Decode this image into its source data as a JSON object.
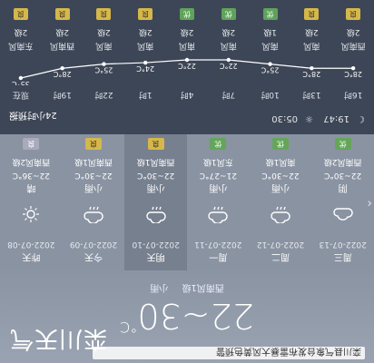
{
  "header": {
    "headline": "栾川县气象台发布雷暴大风黄色预警",
    "city": "栾川天气",
    "temp_range": "22~30",
    "temp_unit": "°C",
    "current_wind_dir": "西南风1级",
    "current_condition": "小雨"
  },
  "days": [
    {
      "name": "周三",
      "date": "2022-07-13",
      "icon": "cloud-icon",
      "cond": "阴",
      "temp": "22~30°C",
      "wind": "西南风2级",
      "aq": "优",
      "aq_level": "good"
    },
    {
      "name": "周二",
      "date": "2022-07-12",
      "icon": "rain-cloud-icon",
      "cond": "小雨",
      "temp": "22~30°C",
      "wind": "南风1级",
      "aq": "优",
      "aq_level": "good"
    },
    {
      "name": "周一",
      "date": "2022-07-11",
      "icon": "rain-cloud-icon",
      "cond": "小雨",
      "temp": "21~27°C",
      "wind": "东风1级",
      "aq": "优",
      "aq_level": "good"
    },
    {
      "name": "明天",
      "date": "2022-07-10",
      "icon": "rain-cloud-icon",
      "cond": "小雨",
      "temp": "22~30°C",
      "wind": "西南风1级",
      "aq": "良",
      "aq_level": "mid"
    },
    {
      "name": "今天",
      "date": "2022-07-09",
      "icon": "rain-cloud-icon",
      "cond": "小雨",
      "temp": "22~30°C",
      "wind": "西南风1级",
      "aq": "良",
      "aq_level": "mid"
    },
    {
      "name": "昨天",
      "date": "2022-07-08",
      "icon": "sun-icon",
      "cond": "晴",
      "temp": "22~36°C",
      "wind": "西南风2级",
      "aq": "良",
      "aq_level": "gray"
    }
  ],
  "hourly": {
    "title": "24小时预报",
    "sunrise": "05:30",
    "sunset": "19:47",
    "hours": [
      "16时",
      "13时",
      "10时",
      "7时",
      "4时",
      "1时",
      "22时",
      "19时",
      "现在"
    ],
    "temps": [
      "28°C",
      "28°C",
      "25°C",
      "22°C",
      "22°C",
      "24°C",
      "25°C",
      "28°C",
      "35°C"
    ],
    "temp_values": [
      28,
      28,
      25,
      22,
      22,
      24,
      25,
      28,
      35
    ],
    "cols": [
      {
        "wind": "西南风",
        "lvl": "2级",
        "aq": "良",
        "aq_level": "mid"
      },
      {
        "wind": "南风",
        "lvl": "2级",
        "aq": "良",
        "aq_level": "mid"
      },
      {
        "wind": "南风",
        "lvl": "1级",
        "aq": "优",
        "aq_level": "good"
      },
      {
        "wind": "南风",
        "lvl": "2级",
        "aq": "优",
        "aq_level": "good"
      },
      {
        "wind": "南风",
        "lvl": "2级",
        "aq": "优",
        "aq_level": "good"
      },
      {
        "wind": "南风",
        "lvl": "2级",
        "aq": "良",
        "aq_level": "mid"
      },
      {
        "wind": "南风",
        "lvl": "2级",
        "aq": "良",
        "aq_level": "mid"
      },
      {
        "wind": "西南风",
        "lvl": "2级",
        "aq": "良",
        "aq_level": "mid"
      },
      {
        "wind": "东南风",
        "lvl": "2级",
        "aq": "良",
        "aq_level": "mid"
      }
    ]
  }
}
